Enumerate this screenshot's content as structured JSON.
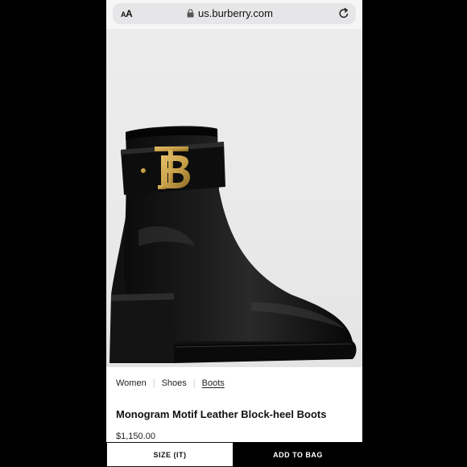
{
  "browser": {
    "text_size_label_small": "A",
    "text_size_label_large": "A",
    "url": "us.burberry.com",
    "icons": {
      "lock": "lock-icon",
      "reload": "reload-icon"
    }
  },
  "product": {
    "image_alt_semantic": "black-leather-ankle-boot-with-gold-tb-monogram",
    "breadcrumb": [
      "Women",
      "Shoes",
      "Boots"
    ],
    "title": "Monogram Motif Leather Block-heel Boots",
    "price": "$1,150.00"
  },
  "actions": {
    "size_label": "SIZE (IT)",
    "add_to_bag_label": "ADD TO BAG"
  },
  "colors": {
    "primary": "#000000",
    "background": "#ffffff",
    "hardware_gold": "#c9a14a"
  }
}
